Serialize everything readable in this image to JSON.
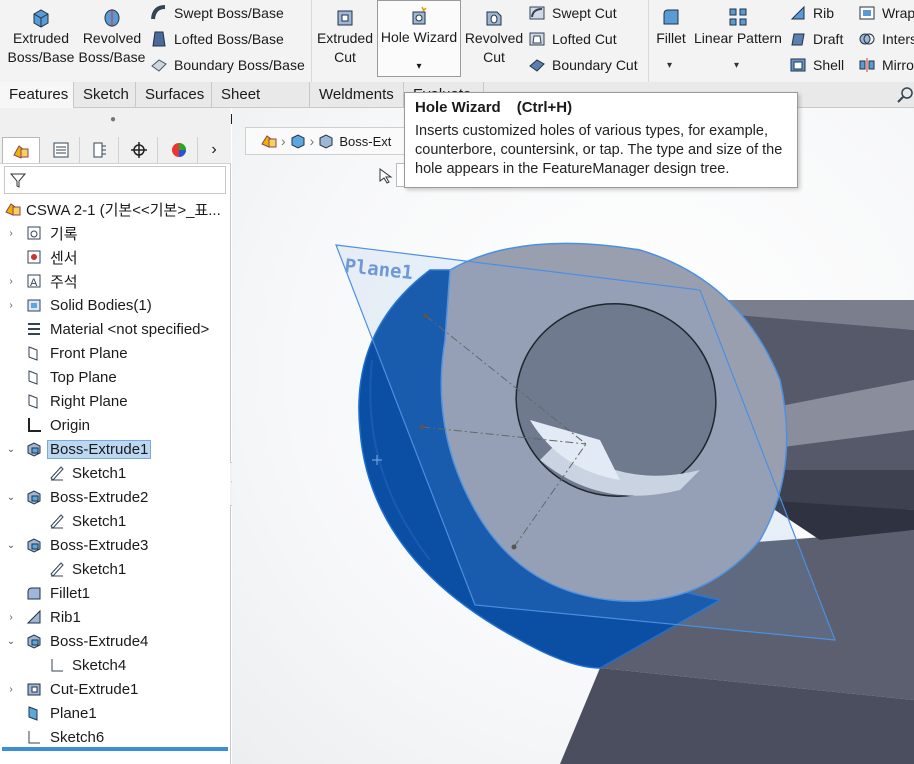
{
  "ribbon": {
    "extruded_boss": "Extruded\nBoss/Base",
    "extruded_boss_l1": "Extruded",
    "extruded_boss_l2": "Boss/Base",
    "revolved_boss_l1": "Revolved",
    "revolved_boss_l2": "Boss/Base",
    "swept_boss": "Swept Boss/Base",
    "lofted_boss": "Lofted Boss/Base",
    "boundary_boss": "Boundary Boss/Base",
    "extruded_cut_l1": "Extruded",
    "extruded_cut_l2": "Cut",
    "hole_wizard": "Hole Wizard",
    "revolved_cut_l1": "Revolved",
    "revolved_cut_l2": "Cut",
    "swept_cut": "Swept Cut",
    "lofted_cut": "Lofted Cut",
    "boundary_cut": "Boundary Cut",
    "fillet": "Fillet",
    "linear_pattern": "Linear Pattern",
    "rib": "Rib",
    "draft": "Draft",
    "shell": "Shell",
    "wrap": "Wrap",
    "intersect": "Inters",
    "mirror": "Mirro",
    "dropdown_arrow": "▾"
  },
  "tabs": [
    "Features",
    "Sketch",
    "Surfaces",
    "Sheet Metal",
    "Weldments",
    "Evaluate"
  ],
  "tooltip": {
    "title": "Hole Wizard",
    "shortcut": "(Ctrl+H)",
    "body": "Inserts customized holes of various types, for example, counterbore, countersink, or tap. The type and size of the hole appears in the FeatureManager design tree."
  },
  "breadcrumb": {
    "label": "Boss-Ext"
  },
  "graphics": {
    "plane_label": "Plane1"
  },
  "tree": {
    "root": "CSWA 2-1  (기본<<기본>_표...",
    "items": [
      {
        "label": "기록",
        "expander": "›"
      },
      {
        "label": "센서",
        "expander": ""
      },
      {
        "label": "주석",
        "expander": "›"
      },
      {
        "label": "Solid Bodies(1)",
        "expander": "›"
      },
      {
        "label": "Material <not specified>",
        "expander": ""
      },
      {
        "label": "Front Plane",
        "expander": ""
      },
      {
        "label": "Top Plane",
        "expander": ""
      },
      {
        "label": "Right Plane",
        "expander": ""
      },
      {
        "label": "Origin",
        "expander": ""
      },
      {
        "label": "Boss-Extrude1",
        "expander": "⌄"
      },
      {
        "label": "Sketch1",
        "expander": ""
      },
      {
        "label": "Boss-Extrude2",
        "expander": "⌄"
      },
      {
        "label": "Sketch1",
        "expander": ""
      },
      {
        "label": "Boss-Extrude3",
        "expander": "⌄"
      },
      {
        "label": "Sketch1",
        "expander": ""
      },
      {
        "label": "Fillet1",
        "expander": ""
      },
      {
        "label": "Rib1",
        "expander": "›"
      },
      {
        "label": "Boss-Extrude4",
        "expander": "⌄"
      },
      {
        "label": "Sketch4",
        "expander": ""
      },
      {
        "label": "Cut-Extrude1",
        "expander": "›"
      },
      {
        "label": "Plane1",
        "expander": ""
      },
      {
        "label": "Sketch6",
        "expander": ""
      }
    ]
  },
  "colors": {
    "selection_blue": "#0a4fa3",
    "plane_blue": "#4a90e2",
    "face_gray": "#9a9fb0"
  }
}
